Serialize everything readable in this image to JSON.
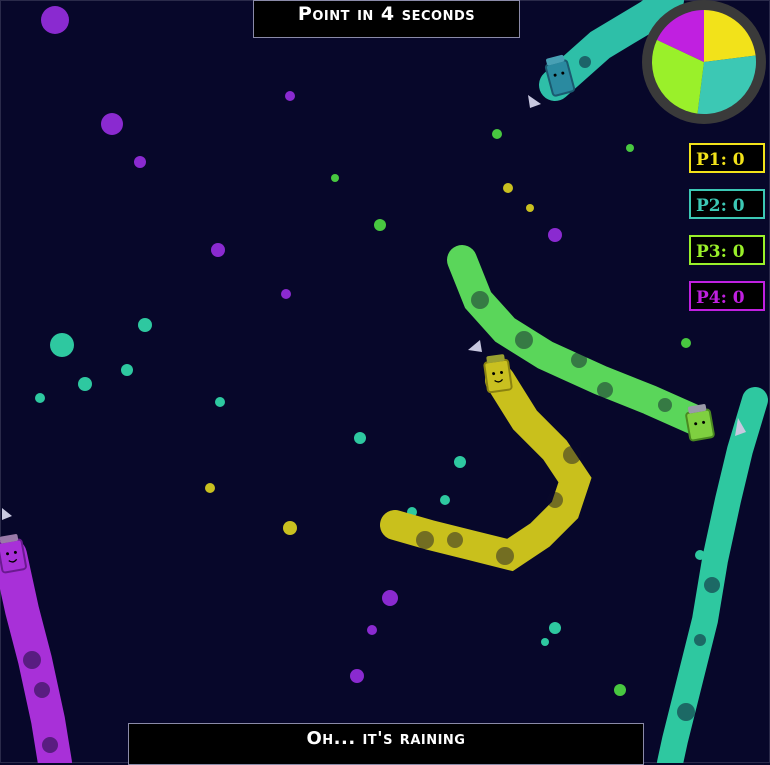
{
  "header": {
    "round_timer_text": "Point in 4 seconds"
  },
  "footer": {
    "event_text": "Oh... it's raining"
  },
  "scoreboard": [
    {
      "label": "P1: 0",
      "color": "#f2e21a"
    },
    {
      "label": "P2: 0",
      "color": "#3cc8b4"
    },
    {
      "label": "P3: 0",
      "color": "#9af02a"
    },
    {
      "label": "P4: 0",
      "color": "#c020e0"
    }
  ],
  "territory_pie": {
    "slices": [
      {
        "player": "P1",
        "color": "#f2e21a",
        "fraction": 0.23
      },
      {
        "player": "P2",
        "color": "#3cc8b4",
        "fraction": 0.29
      },
      {
        "player": "P3",
        "color": "#9af02a",
        "fraction": 0.3
      },
      {
        "player": "P4",
        "color": "#c020e0",
        "fraction": 0.18
      }
    ]
  },
  "players": [
    {
      "name": "P1",
      "color": "#c9c020",
      "icon": "paint-bucket-face-icon"
    },
    {
      "name": "P2",
      "color": "#3cc8b4",
      "icon": "paint-bucket-face-icon"
    },
    {
      "name": "P3",
      "color": "#7fe040",
      "icon": "paint-bucket-face-icon"
    },
    {
      "name": "P4",
      "color": "#c020e0",
      "icon": "paint-bucket-face-icon"
    }
  ],
  "colors": {
    "background": "#07072a",
    "banner_bg": "#000000",
    "pie_rim": "#3a3a3a"
  }
}
